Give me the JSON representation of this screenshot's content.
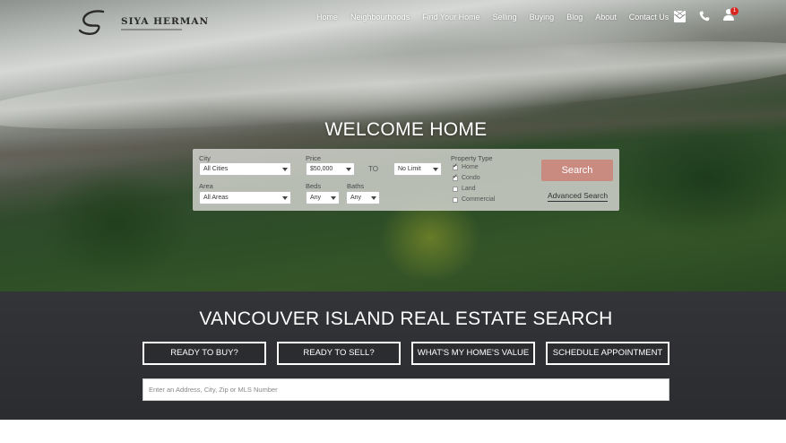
{
  "brand": {
    "logo_text": "SIYA HERMAN"
  },
  "nav": {
    "items": [
      "Home",
      "Neighbourhoods",
      "Find Your Home",
      "Selling",
      "Buying",
      "Blog",
      "About",
      "Contact Us"
    ],
    "icons": [
      "envelope-icon",
      "phone-icon",
      "user-icon"
    ],
    "notification_count": "1"
  },
  "hero": {
    "title": "WELCOME HOME"
  },
  "search": {
    "city_label": "City",
    "city_value": "All Cities",
    "area_label": "Area",
    "area_value": "All Areas",
    "price_label": "Price",
    "price_min": "$50,000",
    "price_to": "TO",
    "price_max": "No Limit",
    "beds_label": "Beds",
    "beds_value": "Any",
    "baths_label": "Baths",
    "baths_value": "Any",
    "property_type_label": "Property Type",
    "property_types": [
      {
        "label": "Home",
        "checked": true
      },
      {
        "label": "Condo",
        "checked": true
      },
      {
        "label": "Land",
        "checked": false
      },
      {
        "label": "Commercial",
        "checked": false
      }
    ],
    "search_button": "Search",
    "advanced_link": "Advanced Search"
  },
  "band": {
    "title": "VANCOUVER ISLAND REAL ESTATE SEARCH",
    "buttons": [
      "READY TO BUY?",
      "READY TO SELL?",
      "WHAT'S MY HOME'S VALUE",
      "SCHEDULE APPOINTMENT"
    ],
    "address_placeholder": "Enter an Address, City, Zip or MLS Number"
  },
  "colors": {
    "search_button": "#c98a80",
    "band_background": "#2e2f33",
    "badge": "#d9251d"
  }
}
